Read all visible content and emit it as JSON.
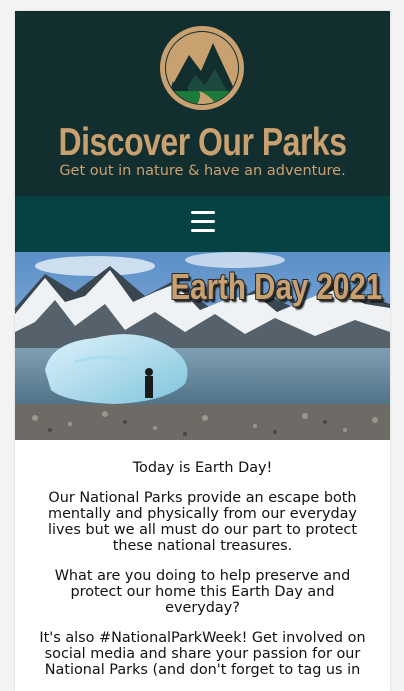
{
  "header": {
    "logo_icon": "mountain-park-logo-icon",
    "title": "Discover Our Parks",
    "tagline": "Get out in nature & have an adventure."
  },
  "nav": {
    "menu_icon": "hamburger-menu-icon"
  },
  "hero": {
    "title": "Earth Day 2021"
  },
  "content": {
    "paragraphs": [
      "Today is Earth Day!",
      "Our National Parks provide an escape both mentally and physically from our everyday lives but we all must do our part to protect these national treasures.",
      "What are you doing to help preserve and protect our home this Earth Day and everyday?",
      "It's also #NationalParkWeek! Get involved on social media and share your passion for our National Parks (and don't forget to tag us in"
    ]
  },
  "colors": {
    "header_bg": "#132e2e",
    "nav_bg": "#064243",
    "accent_gold": "#c9a070"
  }
}
